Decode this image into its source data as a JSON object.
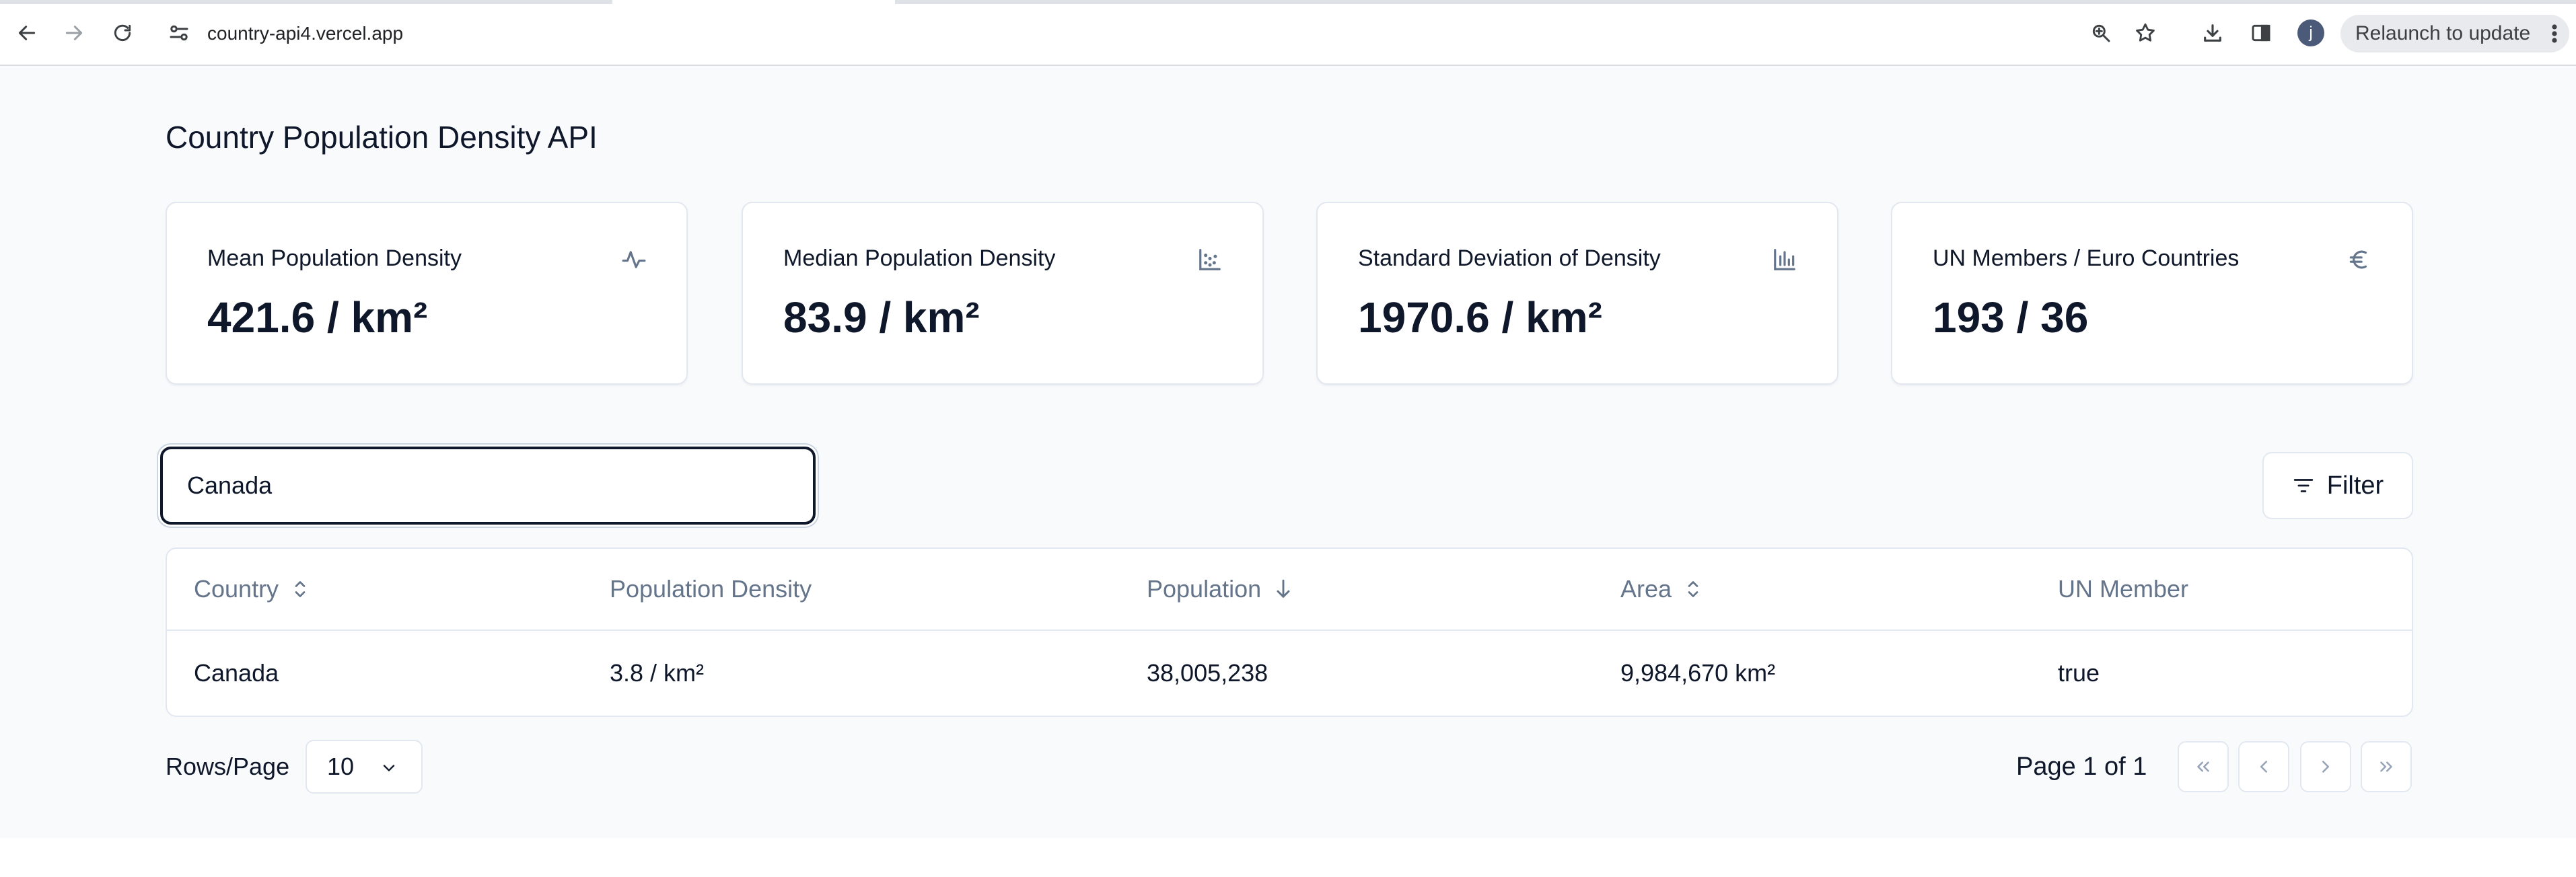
{
  "browser": {
    "url": "country-api4.vercel.app",
    "profile_initial": "j",
    "relaunch_label": "Relaunch to update"
  },
  "page": {
    "title": "Country Population Density API"
  },
  "stats": [
    {
      "label": "Mean Population Density",
      "value": "421.6 / km²",
      "icon": "activity-icon"
    },
    {
      "label": "Median Population Density",
      "value": "83.9 / km²",
      "icon": "scatter-chart-icon"
    },
    {
      "label": "Standard Deviation of Density",
      "value": "1970.6 / km²",
      "icon": "bar-chart-icon"
    },
    {
      "label": "UN Members / Euro Countries",
      "value": "193 / 36",
      "icon": "euro-icon"
    }
  ],
  "search": {
    "value": "Canada"
  },
  "filter": {
    "label": "Filter"
  },
  "table": {
    "columns": [
      {
        "label": "Country",
        "sort": "unsorted"
      },
      {
        "label": "Population Density",
        "sort": "none"
      },
      {
        "label": "Population",
        "sort": "descending"
      },
      {
        "label": "Area",
        "sort": "unsorted"
      },
      {
        "label": "UN Member",
        "sort": "none"
      }
    ],
    "rows": [
      {
        "country": "Canada",
        "density": "3.8 / km²",
        "population": "38,005,238",
        "area": "9,984,670 km²",
        "un_member": "true"
      }
    ]
  },
  "pagination": {
    "rows_label": "Rows/Page",
    "rows_value": "10",
    "page_info": "Page 1 of 1"
  },
  "colors": {
    "page_bg": "#f8fafc",
    "card_border": "#e2e8f0",
    "muted_text": "#64748b",
    "primary_text": "#0f172a"
  }
}
